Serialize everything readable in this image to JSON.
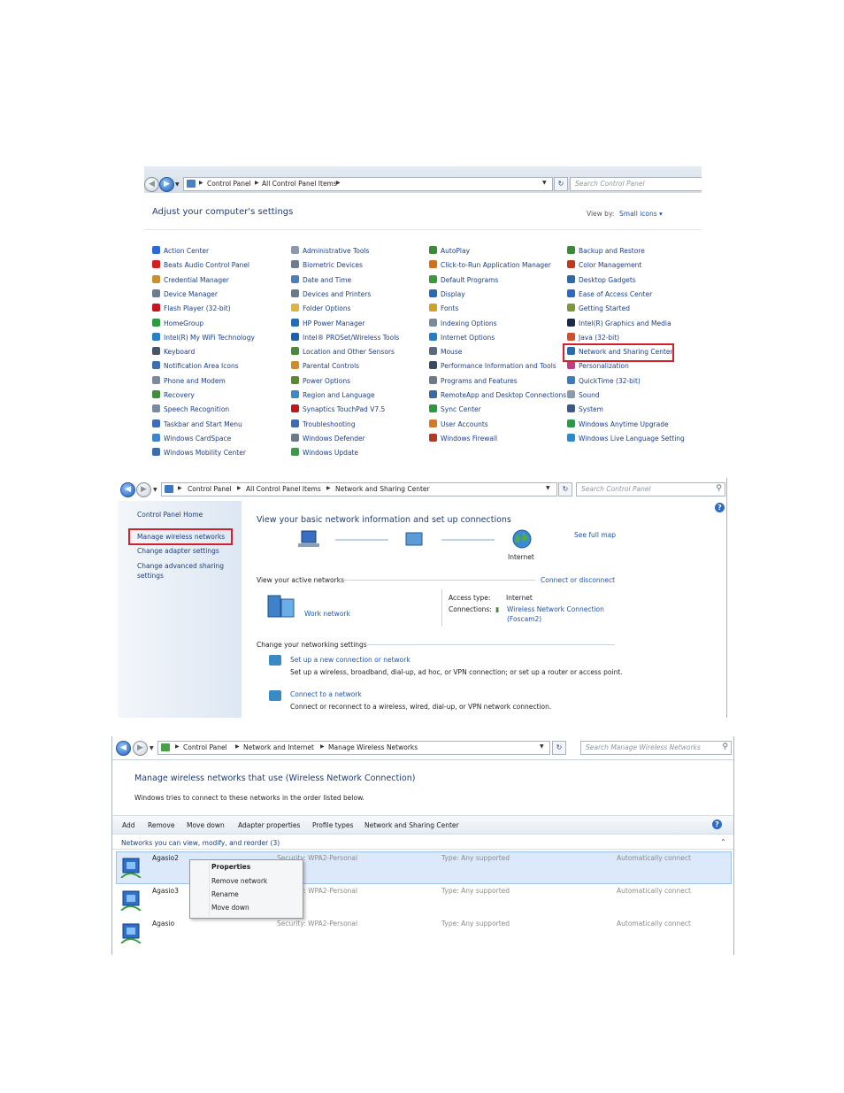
{
  "screen1": {
    "breadcrumbs": [
      "Control Panel",
      "All Control Panel Items"
    ],
    "search_placeholder": "Search Control Panel",
    "heading": "Adjust your computer's settings",
    "view_by_label": "View by:",
    "view_by_value": "Small icons",
    "columns": [
      [
        {
          "label": "Action Center",
          "color": "#2a6bd1"
        },
        {
          "label": "Beats Audio Control Panel",
          "color": "#d11f1f"
        },
        {
          "label": "Credential Manager",
          "color": "#c6902a"
        },
        {
          "label": "Device Manager",
          "color": "#6b7c8f"
        },
        {
          "label": "Flash Player (32-bit)",
          "color": "#c4161c"
        },
        {
          "label": "HomeGroup",
          "color": "#2f9a3f"
        },
        {
          "label": "Intel(R) My WiFi Technology",
          "color": "#2a7fc4"
        },
        {
          "label": "Keyboard",
          "color": "#4a5563"
        },
        {
          "label": "Notification Area Icons",
          "color": "#3d6fb0"
        },
        {
          "label": "Phone and Modem",
          "color": "#7b8a9c"
        },
        {
          "label": "Recovery",
          "color": "#3f8f3a"
        },
        {
          "label": "Speech Recognition",
          "color": "#7b8a9c"
        },
        {
          "label": "Taskbar and Start Menu",
          "color": "#3e6bb3"
        },
        {
          "label": "Windows CardSpace",
          "color": "#3e86c9"
        },
        {
          "label": "Windows Mobility Center",
          "color": "#3b6ea8"
        }
      ],
      [
        {
          "label": "Administrative Tools",
          "color": "#8a9aab"
        },
        {
          "label": "Biometric Devices",
          "color": "#6d7d8e"
        },
        {
          "label": "Date and Time",
          "color": "#4b7fbf"
        },
        {
          "label": "Devices and Printers",
          "color": "#6b7a8a"
        },
        {
          "label": "Folder Options",
          "color": "#e0b43a"
        },
        {
          "label": "HP Power Manager",
          "color": "#1f6fbf"
        },
        {
          "label": "Intel® PROSet/Wireless Tools",
          "color": "#1f5fb0"
        },
        {
          "label": "Location and Other Sensors",
          "color": "#4a8a3a"
        },
        {
          "label": "Parental Controls",
          "color": "#d08a2a"
        },
        {
          "label": "Power Options",
          "color": "#5a8a2a"
        },
        {
          "label": "Region and Language",
          "color": "#3a8ac4"
        },
        {
          "label": "Synaptics TouchPad V7.5",
          "color": "#c4161c"
        },
        {
          "label": "Troubleshooting",
          "color": "#3a6bb3"
        },
        {
          "label": "Windows Defender",
          "color": "#6b7a8a"
        },
        {
          "label": "Windows Update",
          "color": "#3a9a4a"
        }
      ],
      [
        {
          "label": "AutoPlay",
          "color": "#3a8a3a"
        },
        {
          "label": "Click-to-Run Application Manager",
          "color": "#d0701f"
        },
        {
          "label": "Default Programs",
          "color": "#3a9a3a"
        },
        {
          "label": "Display",
          "color": "#2a6ab3"
        },
        {
          "label": "Fonts",
          "color": "#d0a02a"
        },
        {
          "label": "Indexing Options",
          "color": "#7a8a9a"
        },
        {
          "label": "Internet Options",
          "color": "#2a7ac4"
        },
        {
          "label": "Mouse",
          "color": "#5a6a7a"
        },
        {
          "label": "Performance Information and Tools",
          "color": "#3a4a5a"
        },
        {
          "label": "Programs and Features",
          "color": "#6a7a8a"
        },
        {
          "label": "RemoteApp and Desktop Connections",
          "color": "#3a6aa3"
        },
        {
          "label": "Sync Center",
          "color": "#2a9a3a"
        },
        {
          "label": "User Accounts",
          "color": "#d07a2a"
        },
        {
          "label": "Windows Firewall",
          "color": "#b03a2a"
        }
      ],
      [
        {
          "label": "Backup and Restore",
          "color": "#3a8a3a"
        },
        {
          "label": "Color Management",
          "color": "#c4361c"
        },
        {
          "label": "Desktop Gadgets",
          "color": "#2a6ab3"
        },
        {
          "label": "Ease of Access Center",
          "color": "#2a6ac4"
        },
        {
          "label": "Getting Started",
          "color": "#7a9a3a"
        },
        {
          "label": "Intel(R) Graphics and Media",
          "color": "#1a2a4a"
        },
        {
          "label": "Java (32-bit)",
          "color": "#d0502a"
        },
        {
          "label": "Network and Sharing Center",
          "color": "#2a6ab3"
        },
        {
          "label": "Personalization",
          "color": "#c43a8a"
        },
        {
          "label": "QuickTime (32-bit)",
          "color": "#3a7ac4"
        },
        {
          "label": "Sound",
          "color": "#8a9aab"
        },
        {
          "label": "System",
          "color": "#3a5a8a"
        },
        {
          "label": "Windows Anytime Upgrade",
          "color": "#2a9a4a"
        },
        {
          "label": "Windows Live Language Setting",
          "color": "#2a8ad0"
        }
      ]
    ]
  },
  "screen2": {
    "breadcrumbs": [
      "Control Panel",
      "All Control Panel Items",
      "Network and Sharing Center"
    ],
    "search_placeholder": "Search Control Panel",
    "sidebar": {
      "home": "Control Panel Home",
      "manage_wireless": "Manage wireless networks",
      "change_adapter": "Change adapter settings",
      "change_sharing_1": "Change advanced sharing",
      "change_sharing_2": "settings"
    },
    "heading": "View your basic network information and set up connections",
    "see_full_map": "See full map",
    "internet_label": "Internet",
    "active_networks_label": "View your active networks",
    "connect_disconnect": "Connect or disconnect",
    "network_name": "Work network",
    "access_type_label": "Access type:",
    "access_type_value": "Internet",
    "connections_label": "Connections:",
    "connection_name": "Wireless Network Connection",
    "connection_ssid": "(Foscam2)",
    "change_settings_label": "Change your networking settings",
    "setup_link": "Set up a new connection or network",
    "setup_desc": "Set up a wireless, broadband, dial-up, ad hoc, or VPN connection; or set up a router or access point.",
    "connect_link": "Connect to a network",
    "connect_desc": "Connect or reconnect to a wireless, wired, dial-up, or VPN network connection."
  },
  "screen3": {
    "breadcrumbs": [
      "Control Panel",
      "Network and Internet",
      "Manage Wireless Networks"
    ],
    "search_placeholder": "Search Manage Wireless Networks",
    "heading": "Manage wireless networks that use (Wireless Network Connection)",
    "subheading": "Windows tries to connect to these networks in the order listed below.",
    "toolbar": [
      "Add",
      "Remove",
      "Move down",
      "Adapter properties",
      "Profile types",
      "Network and Sharing Center"
    ],
    "group_label": "Networks you can view, modify, and reorder (3)",
    "networks": [
      {
        "name": "Agasio2",
        "security": "Security:  WPA2-Personal",
        "type": "Type:  Any supported",
        "mode": "Automatically connect"
      },
      {
        "name": "Agasio3",
        "security": "Security:  WPA2-Personal",
        "type": "Type:  Any supported",
        "mode": "Automatically connect"
      },
      {
        "name": "Agasio",
        "security": "Security:  WPA2-Personal",
        "type": "Type:  Any supported",
        "mode": "Automatically connect"
      }
    ],
    "context_menu": [
      "Properties",
      "Remove network",
      "Rename",
      "Move down"
    ]
  }
}
